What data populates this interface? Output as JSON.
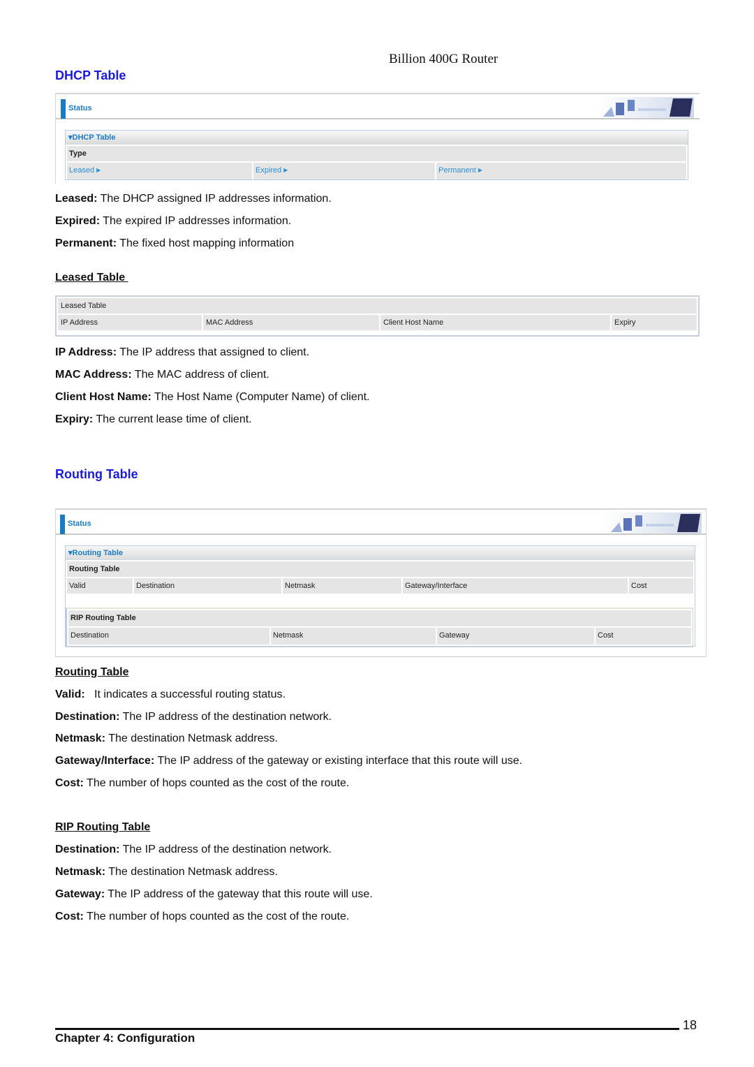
{
  "header": {
    "product": "Billion 400G Router"
  },
  "dhcp": {
    "title": "DHCP Table",
    "ui": {
      "status_label": "Status",
      "box_title": "DHCP Table",
      "type_label": "Type",
      "types": [
        {
          "label": "Leased",
          "icon": "arrow-right-icon"
        },
        {
          "label": "Expired",
          "icon": "arrow-right-icon"
        },
        {
          "label": "Permanent",
          "icon": "arrow-right-icon"
        }
      ]
    },
    "descriptions": [
      {
        "term": "Leased:",
        "text": " The DHCP assigned IP addresses information."
      },
      {
        "term": "Expired:",
        "text": " The expired IP addresses information."
      },
      {
        "term": "Permanent:",
        "text": " The fixed host mapping information"
      }
    ]
  },
  "leased": {
    "title": "Leased Table ",
    "ui": {
      "box_title": "Leased Table",
      "columns": [
        "IP Address",
        "MAC Address",
        "Client Host Name",
        "Expiry"
      ]
    },
    "descriptions": [
      {
        "term": "IP Address:",
        "text": " The IP address that assigned to client."
      },
      {
        "term": "MAC Address:",
        "text": " The MAC address of client."
      },
      {
        "term": "Client Host Name:",
        "text": " The Host Name (Computer Name) of client."
      },
      {
        "term": "Expiry:",
        "text": " The current lease time of client."
      }
    ]
  },
  "routing": {
    "title": "Routing Table",
    "ui": {
      "status_label": "Status",
      "box_title": "Routing Table",
      "routing_label": "Routing Table",
      "routing_columns": [
        "Valid",
        "Destination",
        "Netmask",
        "Gateway/Interface",
        "Cost"
      ],
      "rip_label": "RIP Routing Table",
      "rip_columns": [
        "Destination",
        "Netmask",
        "Gateway",
        "Cost"
      ]
    },
    "sub_title": "Routing Table",
    "descriptions": [
      {
        "term": "Valid:",
        "text": "   It indicates a successful routing status."
      },
      {
        "term": "Destination:",
        "text": " The IP address of the destination network."
      },
      {
        "term": "Netmask:",
        "text": " The destination Netmask address."
      },
      {
        "term": "Gateway/Interface:",
        "text": " The IP address of the gateway or existing interface that this route will use."
      },
      {
        "term": "Cost:",
        "text": " The number of hops counted as the cost of the route."
      }
    ]
  },
  "rip": {
    "sub_title": "RIP Routing Table",
    "descriptions": [
      {
        "term": "Destination:",
        "text": " The IP address of the destination network."
      },
      {
        "term": "Netmask:",
        "text": " The destination Netmask address."
      },
      {
        "term": "Gateway:",
        "text": " The IP address of the gateway that this route will use."
      },
      {
        "term": "Cost:",
        "text": " The number of hops counted as the cost of the route."
      }
    ]
  },
  "footer": {
    "chapter": "Chapter 4: Configuration",
    "page": "18"
  }
}
